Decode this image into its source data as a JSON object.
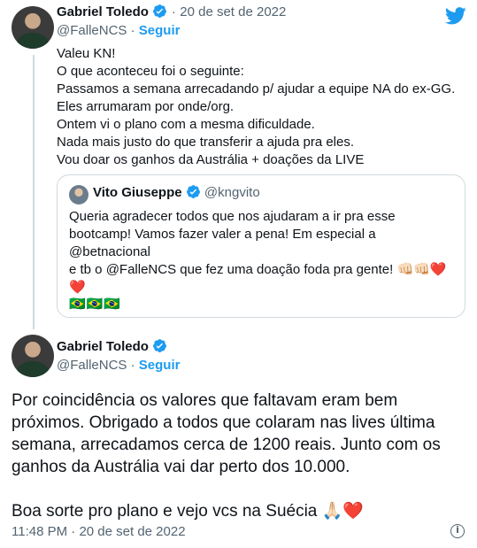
{
  "colors": {
    "accent": "#1d9bf0",
    "muted": "#536471",
    "verified": "#1d9bf0",
    "border": "#cfd9de"
  },
  "tweet1": {
    "author_name": "Gabriel Toledo",
    "separator": "·",
    "date": "20 de set de 2022",
    "handle": "@FalleNCS",
    "follow_label": "Seguir",
    "text_lines": [
      "Valeu KN!",
      "O que aconteceu foi o seguinte:",
      "Passamos a semana arrecadando p/ ajudar a equipe NA do ex-GG.",
      "Eles arrumaram por onde/org.",
      "Ontem vi o plano com a mesma dificuldade.",
      "Nada mais justo do que transferir a ajuda pra eles.",
      "Vou doar os ganhos da Austrália + doações da LIVE"
    ]
  },
  "quote": {
    "author_name": "Vito Giuseppe",
    "handle": "@kngvito",
    "text_lines": [
      "Queria agradecer todos que nos ajudaram a ir pra esse",
      "bootcamp! Vamos fazer valer a pena! Em especial a @betnacional",
      "e tb o @FalleNCS que fez uma doação foda pra gente! 👊🏻👊🏻❤️",
      "❤️"
    ],
    "flags": "🇧🇷🇧🇷🇧🇷"
  },
  "tweet2": {
    "author_name": "Gabriel Toledo",
    "handle": "@FalleNCS",
    "separator": "·",
    "follow_label": "Seguir",
    "text_lines": [
      "Por coincidência os valores que faltavam eram bem",
      "próximos. Obrigado a todos que colaram nas lives última",
      "semana, arrecadamos cerca de 1200 reais. Junto com os",
      "ganhos da Austrália vai dar perto dos 10.000."
    ],
    "text_last": "Boa sorte pro plano e vejo vcs na Suécia 🙏🏻❤️",
    "time": "11:48 PM",
    "date": "20 de set de 2022"
  },
  "icons": [
    "verified-icon",
    "twitter-bird-icon",
    "more-icon",
    "info-icon"
  ]
}
